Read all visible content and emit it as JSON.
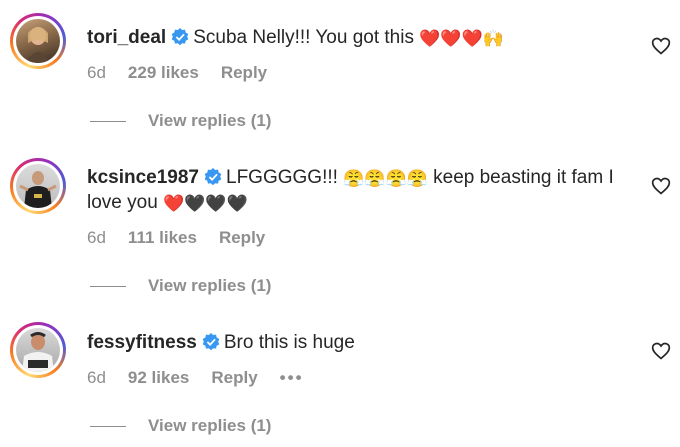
{
  "comments": [
    {
      "username": "tori_deal",
      "text": "Scuba Nelly!!! You got this",
      "emoji": "❤️❤️❤️🙌",
      "age": "6d",
      "likes": "229 likes",
      "reply": "Reply",
      "view_replies": "View replies (1)"
    },
    {
      "username": "kcsince1987",
      "text": "LFGGGGG!!!",
      "emoji": "😤😤😤😤",
      "text2": "keep beasting it fam I",
      "text3": "love you",
      "emoji2": "❤️🖤🖤🖤",
      "age": "6d",
      "likes": "111 likes",
      "reply": "Reply",
      "view_replies": "View replies (1)"
    },
    {
      "username": "fessyfitness",
      "text": "Bro this is huge",
      "age": "6d",
      "likes": "92 likes",
      "reply": "Reply",
      "more": "•••",
      "view_replies": "View replies (1)"
    }
  ],
  "colors": {
    "verified": "#3897f0",
    "secondary_text": "#8e8e8e",
    "primary_text": "#262626"
  },
  "icons": {
    "like": "heart-outline-icon",
    "verified": "verified-badge-icon"
  }
}
